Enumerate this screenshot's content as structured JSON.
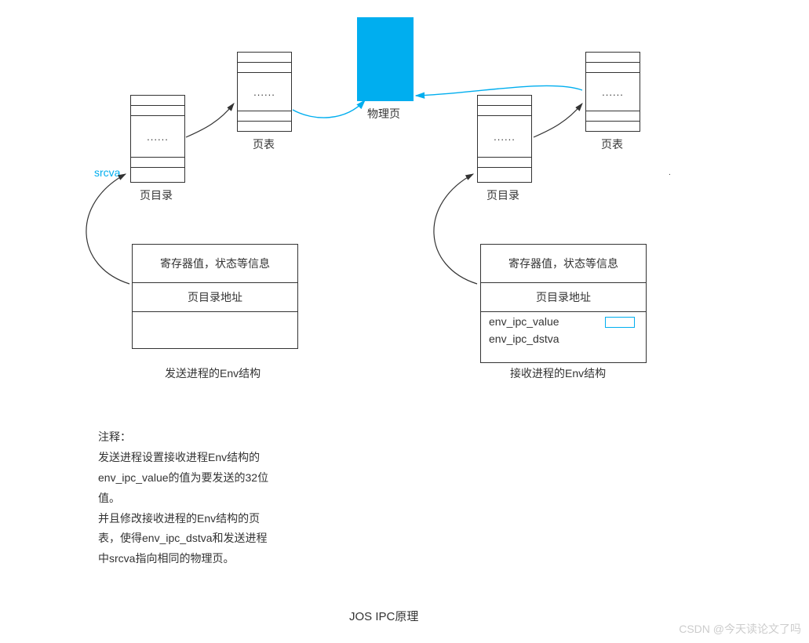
{
  "labels": {
    "srcva": "srcva",
    "pageDir": "页目录",
    "pageTable": "页表",
    "physPage": "物理页",
    "sendEnv": "发送进程的Env结构",
    "recvEnv": "接收进程的Env结构",
    "dots": "......"
  },
  "envSend": {
    "row1": "寄存器值，状态等信息",
    "row2": "页目录地址"
  },
  "envRecv": {
    "row1": "寄存器值，状态等信息",
    "row2": "页目录地址",
    "row3": "env_ipc_value",
    "row4": "env_ipc_dstva"
  },
  "notes": {
    "header": "注释：",
    "l1": "发送进程设置接收进程Env结构的",
    "l2": "env_ipc_value的值为要发送的32位",
    "l3": "值。",
    "l4": "并且修改接收进程的Env结构的页",
    "l5": "表，使得env_ipc_dstva和发送进程",
    "l6": "中srcva指向相同的物理页。"
  },
  "title": "JOS IPC原理",
  "watermark": "CSDN @今天读论文了吗"
}
